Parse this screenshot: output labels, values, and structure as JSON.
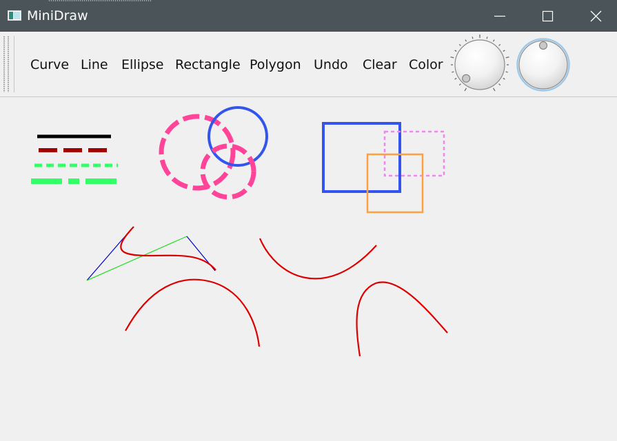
{
  "window": {
    "title": "MiniDraw",
    "icon": "app-window-icon",
    "controls": [
      "minimize-icon",
      "maximize-icon",
      "close-icon"
    ]
  },
  "toolbar": {
    "buttons": [
      {
        "id": "curve",
        "label": "Curve"
      },
      {
        "id": "line",
        "label": "Line"
      },
      {
        "id": "ellipse",
        "label": "Ellipse"
      },
      {
        "id": "rectangle",
        "label": "Rectangle"
      },
      {
        "id": "polygon",
        "label": "Polygon"
      },
      {
        "id": "undo",
        "label": "Undo"
      },
      {
        "id": "clear",
        "label": "Clear"
      },
      {
        "id": "color",
        "label": "Color"
      }
    ],
    "dials": [
      {
        "name": "dial-1",
        "notches": true,
        "indicator_angle_deg": 225
      },
      {
        "name": "dial-2",
        "notches": false,
        "indicator_angle_deg": 0
      }
    ]
  },
  "canvas": {
    "colors": {
      "black": "#000000",
      "dark_red": "#a00000",
      "green": "#33ff66",
      "pink": "#ff4499",
      "blue": "#3355ee",
      "orange": "#ffa040",
      "violet": "#ee88ee",
      "red": "#dd0000",
      "control_green": "#22dd22",
      "control_blue": "#0000cc"
    }
  }
}
